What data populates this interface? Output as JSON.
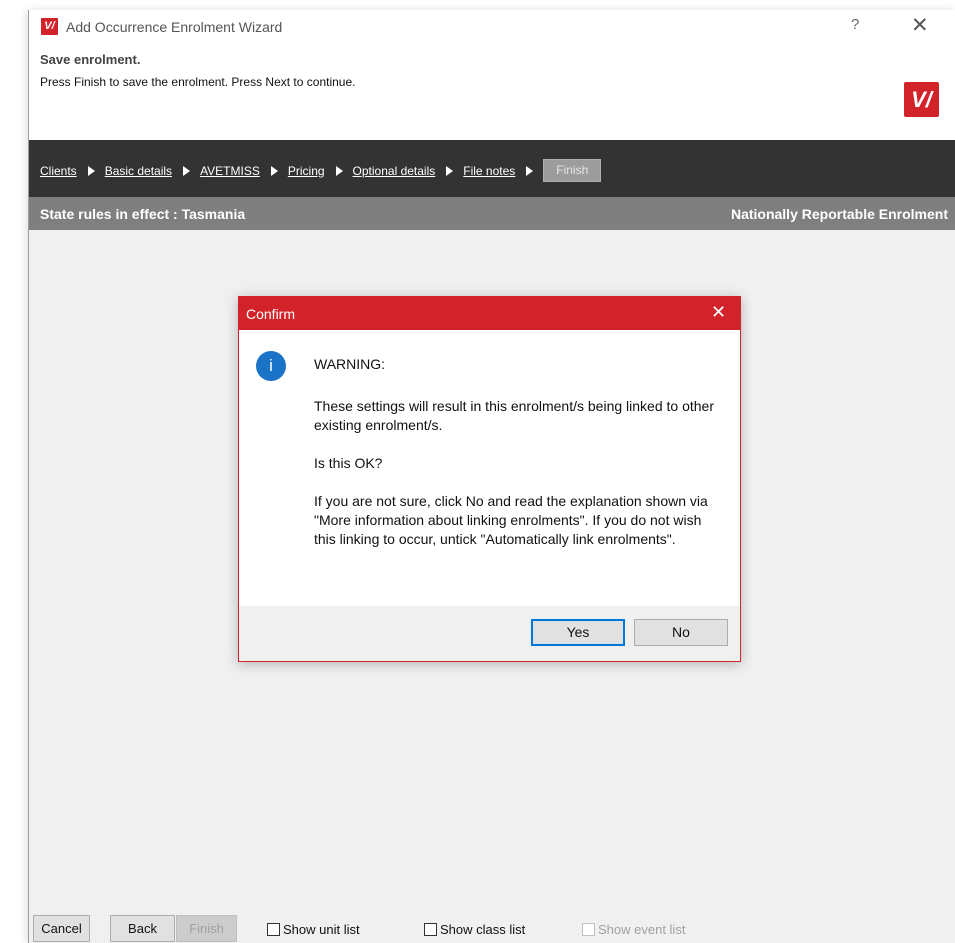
{
  "window": {
    "title": "Add Occurrence Enrolment Wizard",
    "help_label": "?",
    "close_label": "✕",
    "logo_text": "V/"
  },
  "header": {
    "title": "Save enrolment.",
    "subtitle": "Press Finish to save the enrolment.  Press Next to continue."
  },
  "steps": {
    "items": [
      "Clients",
      "Basic details",
      "AVETMISS",
      "Pricing",
      "Optional details",
      "File notes"
    ],
    "finish_label": "Finish"
  },
  "state_bar": {
    "left": "State rules in effect : Tasmania",
    "right": "Nationally Reportable Enrolment"
  },
  "dialog": {
    "title": "Confirm",
    "close_label": "✕",
    "icon_glyph": "i",
    "heading": "WARNING:",
    "paragraph1": "These settings will result in this enrolment/s being linked to other existing enrolment/s.",
    "paragraph2": "Is this OK?",
    "paragraph3": "If you are not sure, click No and read the explanation shown via \"More information about linking enrolments\". If you do not wish this linking to occur, untick \"Automatically link enrolments\".",
    "yes_label": "Yes",
    "no_label": "No"
  },
  "bottom": {
    "cancel_label": "Cancel",
    "back_label": "Back",
    "finish_label": "Finish",
    "show_unit_list": "Show unit list",
    "show_class_list": "Show class list",
    "show_event_list": "Show event list"
  },
  "colors": {
    "brand_red": "#d2232a",
    "step_bar": "#333333",
    "state_bar": "#7f7f7f",
    "focus_blue": "#0078d7"
  }
}
